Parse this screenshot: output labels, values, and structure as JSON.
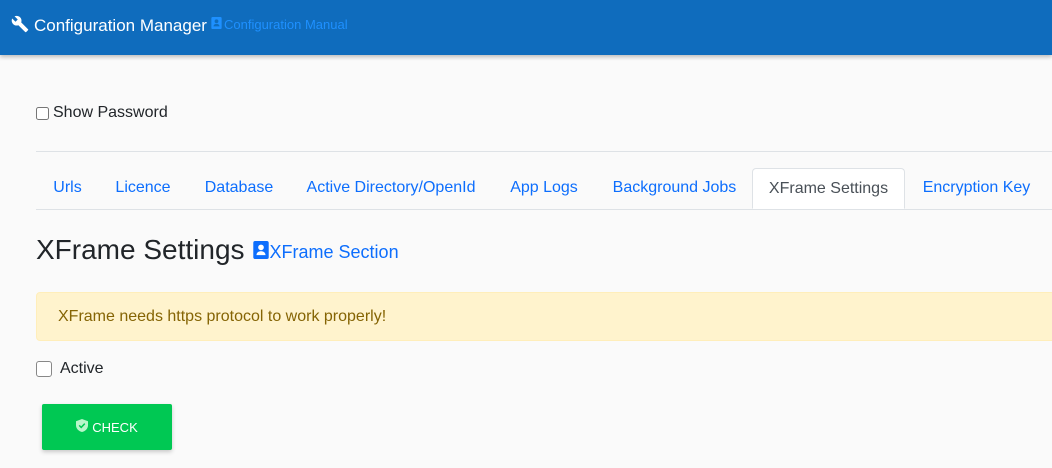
{
  "header": {
    "brand_icon": "wrench-icon",
    "title": "Configuration Manager",
    "manual_icon": "contact-book-icon",
    "manual_link": "Configuration Manual"
  },
  "show_password": {
    "label": "Show Password",
    "checked": false
  },
  "tabs": [
    {
      "label": "Urls",
      "active": false
    },
    {
      "label": "Licence",
      "active": false
    },
    {
      "label": "Database",
      "active": false
    },
    {
      "label": "Active Directory/OpenId",
      "active": false
    },
    {
      "label": "App Logs",
      "active": false
    },
    {
      "label": "Background Jobs",
      "active": false
    },
    {
      "label": "XFrame Settings",
      "active": true
    },
    {
      "label": "Encryption Key",
      "active": false
    }
  ],
  "section": {
    "title": "XFrame Settings",
    "link_icon": "contact-book-icon",
    "link_label": "XFrame Section"
  },
  "alert": {
    "message": "XFrame needs https protocol to work properly!"
  },
  "active_checkbox": {
    "label": "Active",
    "checked": false
  },
  "check_button": {
    "icon": "shield-check-icon",
    "label": "CHECK"
  },
  "colors": {
    "header_bg": "#0f6cbd",
    "link": "#0d6efd",
    "alert_bg": "#fff3cd",
    "alert_text": "#856404",
    "button_bg": "#00c853"
  }
}
